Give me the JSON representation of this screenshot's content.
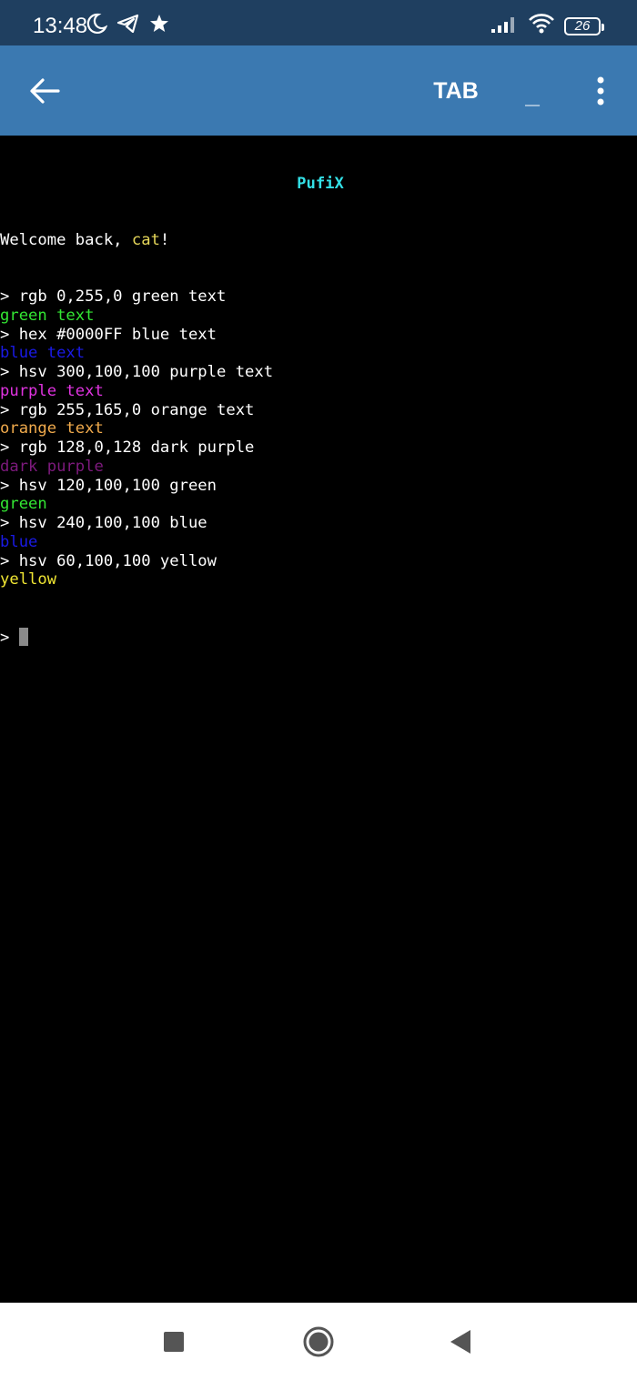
{
  "status_bar": {
    "time": "13:48",
    "battery": "26",
    "left_icons": [
      "moon-icon",
      "telegram-icon",
      "star-icon"
    ],
    "right_icons": [
      "signal-icon",
      "wifi-icon",
      "battery-icon"
    ]
  },
  "app_bar": {
    "tab_label": "TAB",
    "underscore_label": "_",
    "color": "#3b79b1"
  },
  "terminal": {
    "title": "PufiX",
    "welcome_prefix": "Welcome back, ",
    "welcome_user": "cat",
    "welcome_suffix": "!",
    "prompt": ">",
    "lines": [
      {
        "type": "cmd",
        "text": "> rgb 0,255,0 green text"
      },
      {
        "type": "out",
        "text": "green text",
        "color": "#33e633"
      },
      {
        "type": "cmd",
        "text": "> hex #0000FF blue text"
      },
      {
        "type": "out",
        "text": "blue text",
        "color": "#1a1ae6"
      },
      {
        "type": "cmd",
        "text": "> hsv 300,100,100 purple text"
      },
      {
        "type": "out",
        "text": "purple text",
        "color": "#e033e0"
      },
      {
        "type": "cmd",
        "text": "> rgb 255,165,0 orange text"
      },
      {
        "type": "out",
        "text": "orange text",
        "color": "#f0aa4c"
      },
      {
        "type": "cmd",
        "text": "> rgb 128,0,128 dark purple"
      },
      {
        "type": "out",
        "text": "dark purple",
        "color": "#7d1a7d"
      },
      {
        "type": "cmd",
        "text": "> hsv 120,100,100 green"
      },
      {
        "type": "out",
        "text": "green",
        "color": "#33e633"
      },
      {
        "type": "cmd",
        "text": "> hsv 240,100,100 blue"
      },
      {
        "type": "out",
        "text": "blue",
        "color": "#1a1ae6"
      },
      {
        "type": "cmd",
        "text": "> hsv 60,100,100 yellow"
      },
      {
        "type": "out",
        "text": "yellow",
        "color": "#f0e633"
      }
    ]
  },
  "nav_bar": {
    "icons": [
      "recents-icon",
      "home-icon",
      "back-icon"
    ]
  }
}
